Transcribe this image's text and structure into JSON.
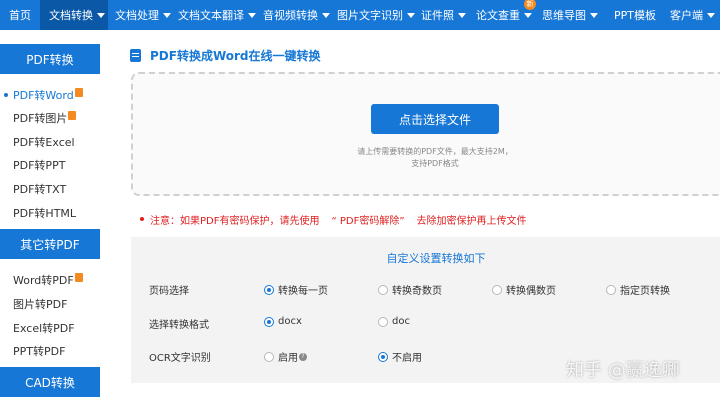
{
  "nav": {
    "items": [
      {
        "label": "首页"
      },
      {
        "label": "文档转换",
        "active": true,
        "caret": true
      },
      {
        "label": "文档处理",
        "caret": true
      },
      {
        "label": "文档文本翻译",
        "caret": true
      },
      {
        "label": "音视频转换",
        "caret": true
      },
      {
        "label": "图片文字识别",
        "caret": true
      },
      {
        "label": "证件照",
        "caret": true
      },
      {
        "label": "论文查重",
        "caret": true,
        "badge": "新"
      },
      {
        "label": "思维导图",
        "caret": true
      },
      {
        "label": "PPT模板"
      },
      {
        "label": "客户端",
        "caret": true
      }
    ]
  },
  "sidebar": {
    "sections": [
      {
        "title": "PDF转换",
        "items": [
          "PDF转Word",
          "PDF转图片",
          "PDF转Excel",
          "PDF转PPT",
          "PDF转TXT",
          "PDF转HTML"
        ]
      },
      {
        "title": "其它转PDF",
        "items": [
          "Word转PDF",
          "图片转PDF",
          "Excel转PDF",
          "PPT转PDF"
        ]
      },
      {
        "title": "CAD转换",
        "items": []
      }
    ]
  },
  "main": {
    "title": "PDF转换成Word在线一键转换",
    "upload_button": "点击选择文件",
    "upload_hint_line1": "请上传需要转换的PDF文件，最大支持2M，",
    "upload_hint_line2": "支持PDF格式",
    "notice_prefix": "注意：如果PDF有密码保护，请先使用",
    "notice_link": "“ PDF密码解除”",
    "notice_suffix": "去除加密保护再上传文件",
    "settings_title": "自定义设置转换如下",
    "rows": [
      {
        "label": "页码选择",
        "options": [
          "转换每一页",
          "转换奇数页",
          "转换偶数页",
          "指定页转换"
        ],
        "selected": 0
      },
      {
        "label": "选择转换格式",
        "options": [
          "docx",
          "doc"
        ],
        "selected": 0
      },
      {
        "label": "OCR文字识别",
        "options": [
          "启用",
          "不启用"
        ],
        "selected": 1
      }
    ]
  },
  "watermark": "知乎 @赢逸卿",
  "colors": {
    "accent": "#1777d6",
    "nav_active": "#0b58a6",
    "warning": "#e02020",
    "hot": "#f38b20"
  }
}
